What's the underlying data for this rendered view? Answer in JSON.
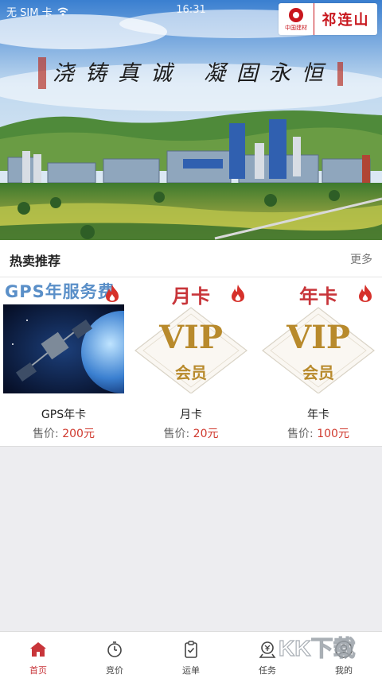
{
  "status_bar": {
    "carrier": "无 SIM 卡",
    "time": "16:31"
  },
  "banner": {
    "brand_name": "祁连山",
    "brand_sub": "中国建材",
    "calligraphy_left": "浇铸真诚",
    "calligraphy_right": "凝固永恒"
  },
  "section": {
    "title": "热卖推荐",
    "more": "更多"
  },
  "products": [
    {
      "card_title": "GPS年服务费",
      "name": "GPS年卡",
      "price_label": "售价:",
      "price": "200元",
      "image": "satellite-earth"
    },
    {
      "card_title": "月卡",
      "badge_text": "VIP",
      "badge_sub": "会员",
      "name": "月卡",
      "price_label": "售价:",
      "price": "20元",
      "image": "vip-badge"
    },
    {
      "card_title": "年卡",
      "badge_text": "VIP",
      "badge_sub": "会员",
      "name": "年卡",
      "price_label": "售价:",
      "price": "100元",
      "image": "vip-badge"
    }
  ],
  "tabs": [
    {
      "label": "首页",
      "icon": "home-icon",
      "active": true
    },
    {
      "label": "竞价",
      "icon": "stopwatch-icon"
    },
    {
      "label": "运单",
      "icon": "clipboard-check-icon"
    },
    {
      "label": "任务",
      "icon": "money-pin-icon"
    },
    {
      "label": "我的",
      "icon": "user-icon"
    }
  ],
  "colors": {
    "accent": "#c8353a",
    "brand_red": "#c8161d",
    "vip_gold": "#b88a2c",
    "gps_blue": "#5a8fc8"
  },
  "watermark": "KK下载"
}
